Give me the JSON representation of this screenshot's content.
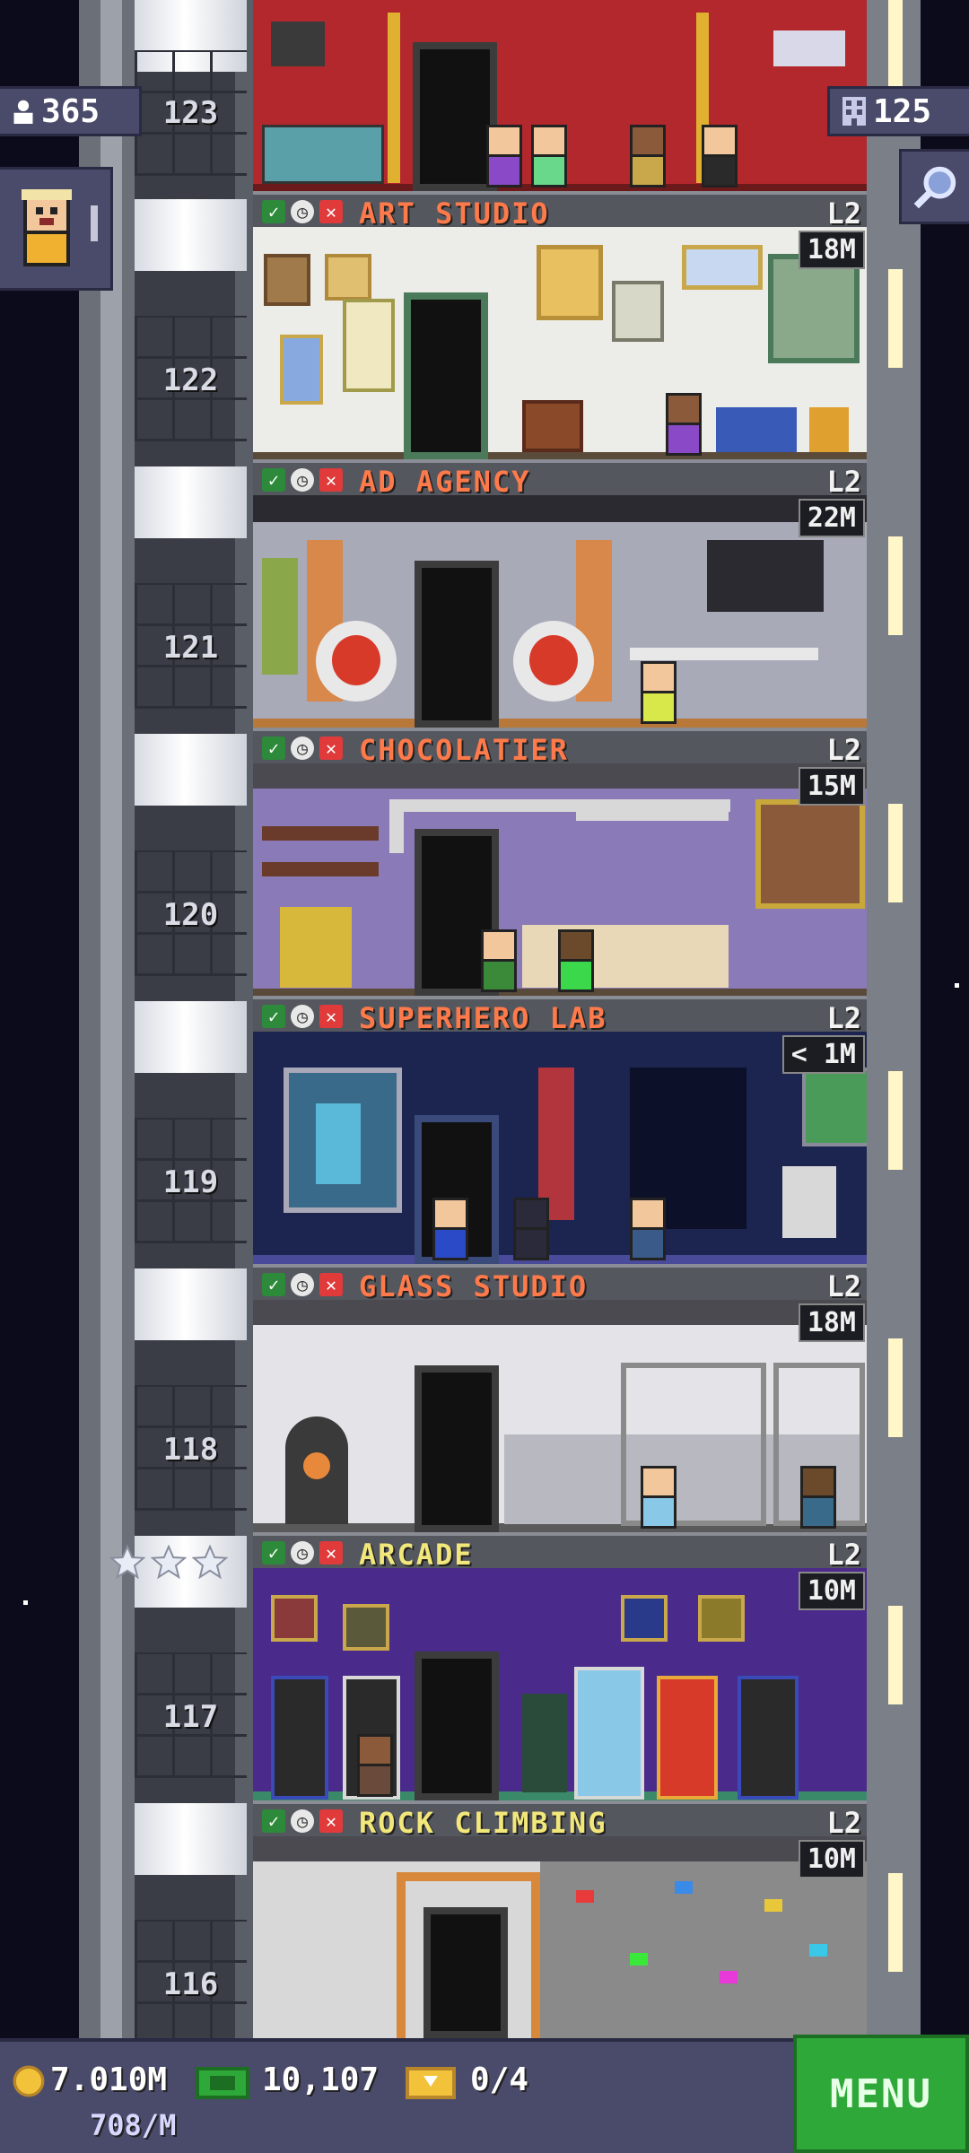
{
  "hud": {
    "population": "365",
    "floors": "125",
    "coins": "7.010M",
    "coin_rate": "708/M",
    "bux": "10,107",
    "tickets": "0/4",
    "menu_label": "MENU"
  },
  "floors": [
    {
      "number": "123",
      "name": "",
      "level": "",
      "profit": ""
    },
    {
      "number": "122",
      "name": "ART STUDIO",
      "level": "L2",
      "profit": "18M"
    },
    {
      "number": "121",
      "name": "AD AGENCY",
      "level": "L2",
      "profit": "22M"
    },
    {
      "number": "120",
      "name": "CHOCOLATIER",
      "level": "L2",
      "profit": "15M"
    },
    {
      "number": "119",
      "name": "SUPERHERO LAB",
      "level": "L2",
      "profit": "< 1M"
    },
    {
      "number": "118",
      "name": "GLASS STUDIO",
      "level": "L2",
      "profit": "18M"
    },
    {
      "number": "117",
      "name": "ARCADE",
      "level": "L2",
      "profit": "10M"
    },
    {
      "number": "116",
      "name": "ROCK CLIMBING",
      "level": "L2",
      "profit": "10M"
    }
  ],
  "colors": {
    "sky": "#0c0b1c",
    "panel": "#4a4a6a",
    "menu_green": "#2fa83a",
    "floor_name_orange": "#ff7a4a",
    "floor_name_yellow": "#f2e77a"
  },
  "icons": [
    "person-icon",
    "building-icon",
    "search-icon",
    "coin-icon",
    "bux-icon",
    "ticket-icon",
    "check-icon",
    "clock-icon",
    "close-icon",
    "star-icon"
  ]
}
